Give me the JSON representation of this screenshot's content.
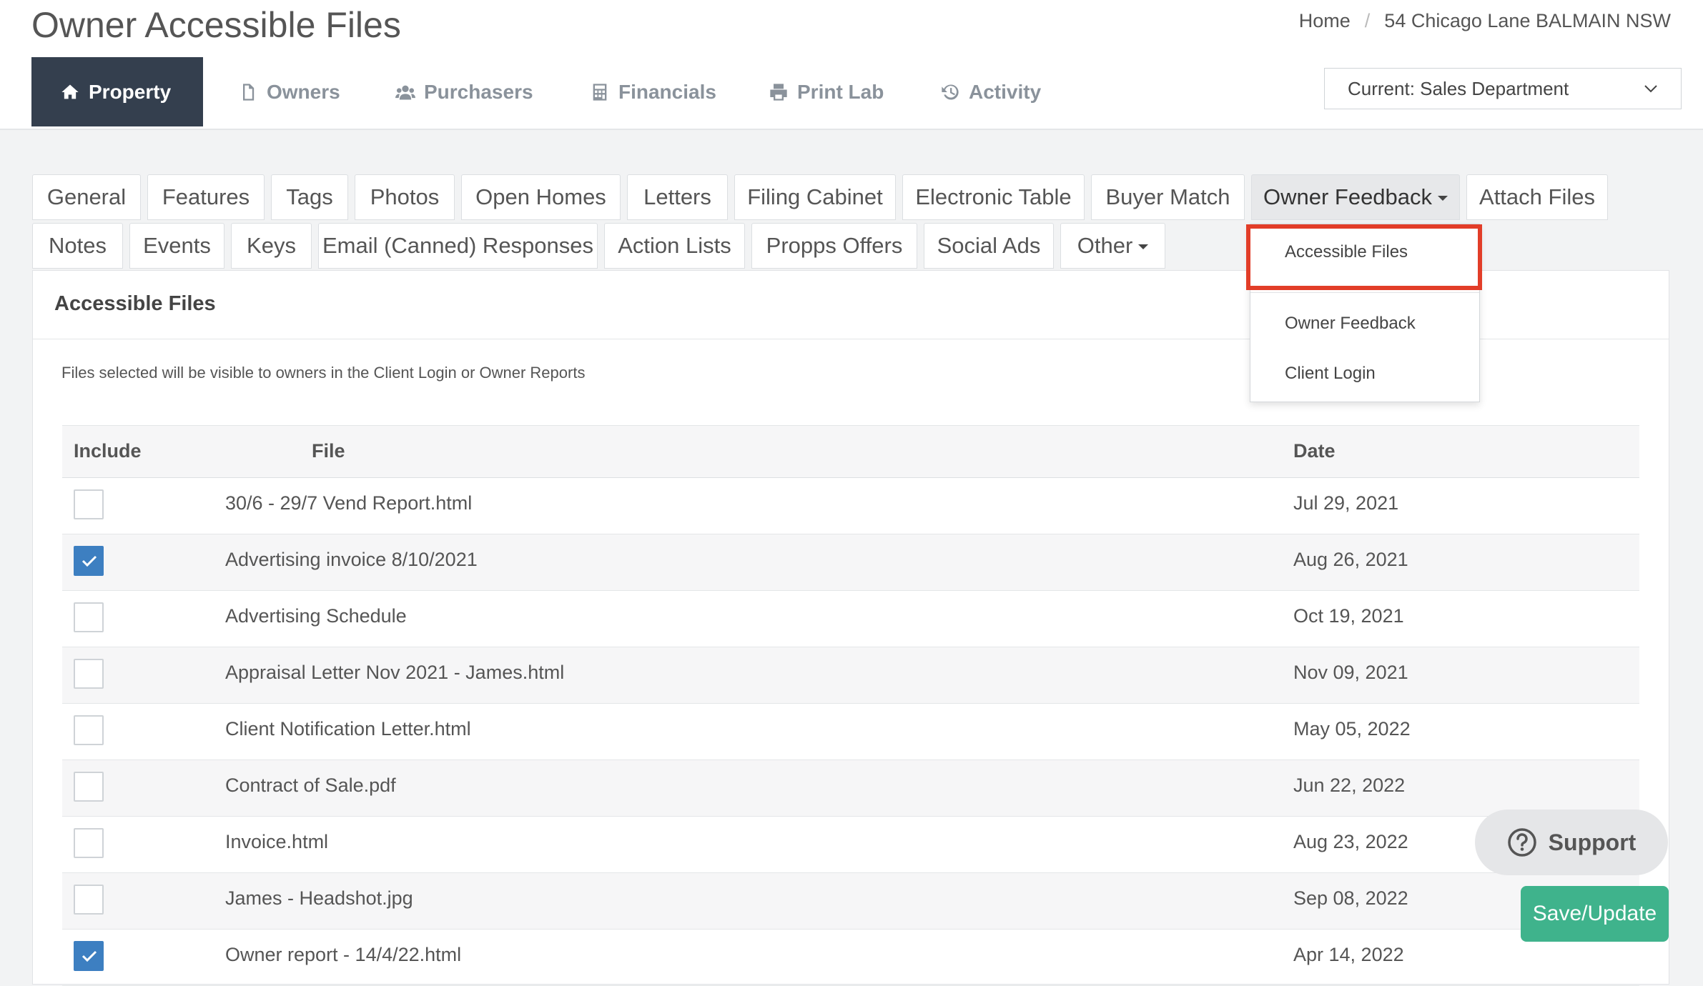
{
  "header": {
    "title": "Owner Accessible Files",
    "breadcrumb": {
      "home": "Home",
      "separator": "/",
      "current": "54 Chicago Lane BALMAIN NSW"
    }
  },
  "nav": {
    "items": [
      {
        "label": "Property",
        "icon": "home-icon",
        "active": true
      },
      {
        "label": "Owners",
        "icon": "document-icon"
      },
      {
        "label": "Purchasers",
        "icon": "users-icon"
      },
      {
        "label": "Financials",
        "icon": "calculator-icon"
      },
      {
        "label": "Print Lab",
        "icon": "printer-icon"
      },
      {
        "label": "Activity",
        "icon": "history-icon"
      }
    ],
    "department_select": "Current: Sales Department"
  },
  "tabs": {
    "row1": [
      "General",
      "Features",
      "Tags",
      "Photos",
      "Open Homes",
      "Letters",
      "Filing Cabinet",
      "Electronic Table",
      "Buyer Match",
      "Owner Feedback",
      "Attach Files"
    ],
    "row2": [
      "Notes",
      "Events",
      "Keys",
      "Email (Canned) Responses",
      "Action Lists",
      "Propps Offers",
      "Social Ads",
      "Other"
    ]
  },
  "dropdown": {
    "items": [
      "Accessible Files",
      "Owner Feedback",
      "Client Login"
    ]
  },
  "panel": {
    "title": "Accessible Files",
    "note": "Files selected will be visible to owners in the Client Login or Owner Reports",
    "columns": [
      "Include",
      "File",
      "Date"
    ],
    "rows": [
      {
        "file": "30/6 - 29/7 Vend Report.html",
        "date": "Jul 29, 2021",
        "checked": false
      },
      {
        "file": "Advertising invoice 8/10/2021",
        "date": "Aug 26, 2021",
        "checked": true
      },
      {
        "file": "Advertising Schedule",
        "date": "Oct 19, 2021",
        "checked": false
      },
      {
        "file": "Appraisal Letter Nov 2021 - James.html",
        "date": "Nov 09, 2021",
        "checked": false
      },
      {
        "file": "Client Notification Letter.html",
        "date": "May 05, 2022",
        "checked": false
      },
      {
        "file": "Contract of Sale.pdf",
        "date": "Jun 22, 2022",
        "checked": false
      },
      {
        "file": "Invoice.html",
        "date": "Aug 23, 2022",
        "checked": false
      },
      {
        "file": "James - Headshot.jpg",
        "date": "Sep 08, 2022",
        "checked": false
      },
      {
        "file": "Owner report - 14/4/22.html",
        "date": "Apr 14, 2022",
        "checked": true
      }
    ]
  },
  "floating": {
    "support": "Support",
    "save": "Save/Update"
  },
  "colors": {
    "nav_active": "#343f4e",
    "checkbox": "#3d7fc1",
    "highlight": "#e23d28",
    "save": "#3fb38c"
  }
}
